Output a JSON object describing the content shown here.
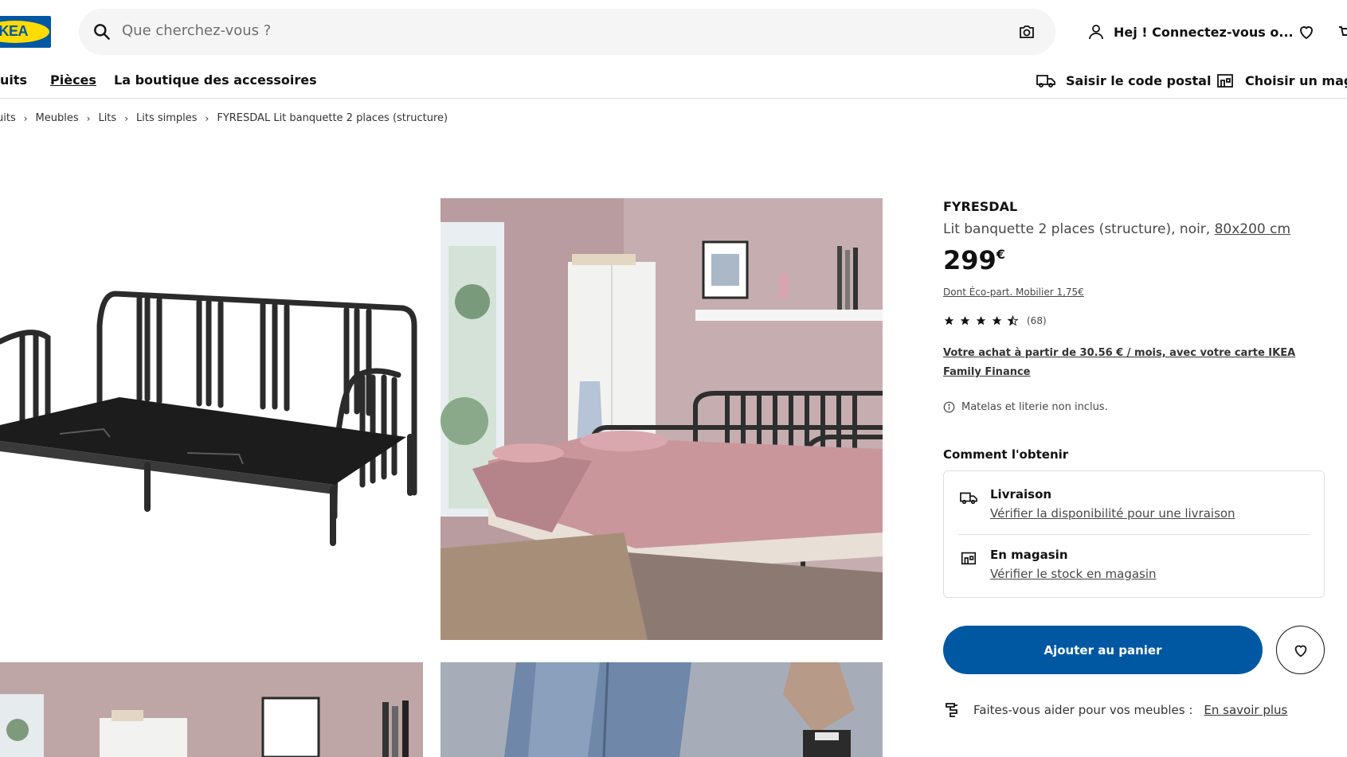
{
  "header": {
    "logo_text": "IKEA",
    "search_placeholder": "Que cherchez-vous ?",
    "account_label": "Hej ! Connectez-vous o..."
  },
  "nav": {
    "items": [
      "uits",
      "Pièces",
      "La boutique des accessoires"
    ],
    "postal_label": "Saisir le code postal",
    "store_label": "Choisir un magas"
  },
  "breadcrumb": [
    "uits",
    "Meubles",
    "Lits",
    "Lits simples",
    "FYRESDAL Lit banquette 2 places (structure)"
  ],
  "product": {
    "brand": "FYRESDAL",
    "description": "Lit banquette 2 places (structure), noir,",
    "size_link": "80x200 cm",
    "price": "299",
    "currency": "€",
    "eco_part": "Dont Éco-part. Mobilier 1,75€",
    "rating_value": 4.5,
    "rating_count": "(68)",
    "finance_text": "Votre achat à partir de 30.56 € / mois, avec votre carte IKEA Family Finance",
    "info_text": "Matelas et literie non inclus."
  },
  "obtain": {
    "title": "Comment l'obtenir",
    "delivery_title": "Livraison",
    "delivery_link": "Vérifier la disponibilité pour une livraison",
    "store_title": "En magasin",
    "store_link": "Vérifier le stock en magasin"
  },
  "actions": {
    "add_to_cart": "Ajouter au panier"
  },
  "help": {
    "text": "Faites-vous aider pour vos meubles :",
    "link": "En savoir plus"
  },
  "colors": {
    "accent": "#0058a3",
    "logo_yellow": "#ffdb00"
  }
}
